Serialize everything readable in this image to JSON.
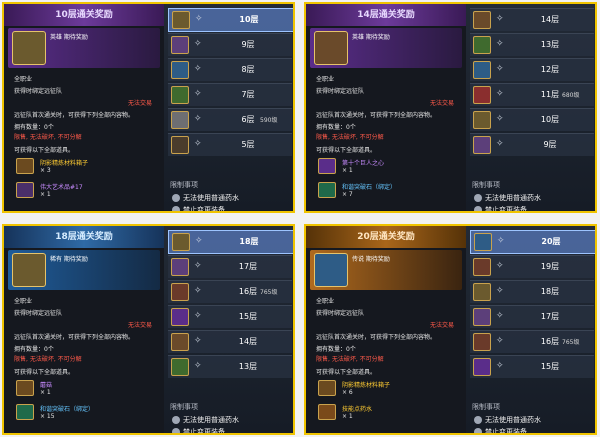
{
  "panels": [
    {
      "title": "10层通关奖励",
      "banner_label": "英雄 期待奖励",
      "career": "全职业",
      "bind": "获得时绑定远征队",
      "no_trade": "无法交易",
      "desc": "远征队首次通关时，可获得下列全部内容物。",
      "owned": "拥有数量：0个",
      "unbreakable": "限售, 无法破坏, 不可分解",
      "gain": "可获得以下全部道具。",
      "rewards": [
        {
          "name": "阴影精炼材料箱子",
          "qty": "× 3",
          "color": "#ffcc33",
          "icon_bg": "#6b4a1f"
        },
        {
          "name": "伟大艺术品#17",
          "qty": "× 1",
          "color": "#c88bff",
          "icon_bg": "#4a2f6a"
        }
      ],
      "rows": [
        {
          "floor": "10层",
          "selected": true,
          "extra": "",
          "icon_bg": "#6b5a2e"
        },
        {
          "floor": "9层",
          "selected": false,
          "extra": "",
          "icon_bg": "#5c3f7a"
        },
        {
          "floor": "8层",
          "selected": false,
          "extra": "",
          "icon_bg": "#2e5c86"
        },
        {
          "floor": "7层",
          "selected": false,
          "extra": "",
          "icon_bg": "#3f6a2e"
        },
        {
          "floor": "6层",
          "selected": false,
          "extra": "590级",
          "icon_bg": "#6e6e72"
        },
        {
          "floor": "5层",
          "selected": false,
          "extra": "",
          "icon_bg": "#4a3c2c"
        }
      ],
      "limit": "限制事项",
      "notes": [
        "无法使用普通药水",
        "禁止变更装备"
      ]
    },
    {
      "title": "14层通关奖励",
      "banner_label": "英雄 期待奖励",
      "career": "全职业",
      "bind": "获得时绑定远征队",
      "no_trade": "无法交易",
      "desc": "远征队首次通关时，可获得下列全部内容物。",
      "owned": "拥有数量：0个",
      "unbreakable": "限售, 无法破坏, 不可分解",
      "gain": "可获得以下全部道具。",
      "rewards": [
        {
          "name": "第十个巨人之心",
          "qty": "× 1",
          "color": "#c88bff",
          "icon_bg": "#5a2d8a"
        },
        {
          "name": "和谐突破石（绑定）",
          "qty": "× 7",
          "color": "#66c6ff",
          "icon_bg": "#1f6a4a"
        }
      ],
      "rows": [
        {
          "floor": "14层",
          "selected": false,
          "extra": "",
          "icon_bg": "#6a4a2a"
        },
        {
          "floor": "13层",
          "selected": false,
          "extra": "",
          "icon_bg": "#3f6a2e"
        },
        {
          "floor": "12层",
          "selected": false,
          "extra": "",
          "icon_bg": "#2e5c86"
        },
        {
          "floor": "11层",
          "selected": false,
          "extra": "680级",
          "icon_bg": "#8a2e2e"
        },
        {
          "floor": "10层",
          "selected": false,
          "extra": "",
          "icon_bg": "#6b5a2e"
        },
        {
          "floor": "9层",
          "selected": false,
          "extra": "",
          "icon_bg": "#5c3f7a"
        }
      ],
      "limit": "限制事项",
      "notes": [
        "无法使用普通药水",
        "禁止变更装备"
      ]
    },
    {
      "title": "18层通关奖励",
      "banner_label": "稀有 期待奖励",
      "career": "全职业",
      "bind": "获得时绑定远征队",
      "no_trade": "无法交易",
      "desc": "远征队首次通关时，可获得下列全部内容物。",
      "owned": "拥有数量：0个",
      "unbreakable": "限售, 无法破坏, 不可分解",
      "gain": "可获得以下全部道具。",
      "rewards": [
        {
          "name": "蘑菇",
          "qty": "× 1",
          "color": "#c88bff",
          "icon_bg": "#6b4a1f"
        },
        {
          "name": "和谐突破石（绑定）",
          "qty": "× 15",
          "color": "#66c6ff",
          "icon_bg": "#1f6a4a"
        }
      ],
      "rows": [
        {
          "floor": "18层",
          "selected": true,
          "extra": "",
          "icon_bg": "#6b5a2e"
        },
        {
          "floor": "17层",
          "selected": false,
          "extra": "",
          "icon_bg": "#5c3f7a"
        },
        {
          "floor": "16层",
          "selected": false,
          "extra": "765级",
          "icon_bg": "#6a3a2a"
        },
        {
          "floor": "15层",
          "selected": false,
          "extra": "",
          "icon_bg": "#5a2d8a"
        },
        {
          "floor": "14层",
          "selected": false,
          "extra": "",
          "icon_bg": "#6a4a2a"
        },
        {
          "floor": "13层",
          "selected": false,
          "extra": "",
          "icon_bg": "#3f6a2e"
        }
      ],
      "limit": "限制事项",
      "notes": [
        "无法使用普通药水",
        "禁止变更装备"
      ]
    },
    {
      "title": "20层通关奖励",
      "banner_label": "传说 期待奖励",
      "career": "全职业",
      "bind": "获得时绑定远征队",
      "no_trade": "无法交易",
      "desc": "远征队首次通关时，可获得下列全部内容物。",
      "owned": "拥有数量：0个",
      "unbreakable": "限售, 无法破坏, 不可分解",
      "gain": "可获得以下全部道具。",
      "rewards": [
        {
          "name": "阴影精炼材料箱子",
          "qty": "× 6",
          "color": "#ffcc33",
          "icon_bg": "#6b4a1f"
        },
        {
          "name": "技能点药水",
          "qty": "× 1",
          "color": "#ffcc33",
          "icon_bg": "#7a4a1a"
        }
      ],
      "rows": [
        {
          "floor": "20层",
          "selected": true,
          "extra": "",
          "icon_bg": "#2e5c86"
        },
        {
          "floor": "19层",
          "selected": false,
          "extra": "",
          "icon_bg": "#6a3a2a"
        },
        {
          "floor": "18层",
          "selected": false,
          "extra": "",
          "icon_bg": "#6b5a2e"
        },
        {
          "floor": "17层",
          "selected": false,
          "extra": "",
          "icon_bg": "#5c3f7a"
        },
        {
          "floor": "16层",
          "selected": false,
          "extra": "765级",
          "icon_bg": "#6a3a2a"
        },
        {
          "floor": "15层",
          "selected": false,
          "extra": "",
          "icon_bg": "#5a2d8a"
        }
      ],
      "limit": "限制事项",
      "notes": [
        "无法使用普通药水",
        "禁止变更装备"
      ]
    }
  ]
}
